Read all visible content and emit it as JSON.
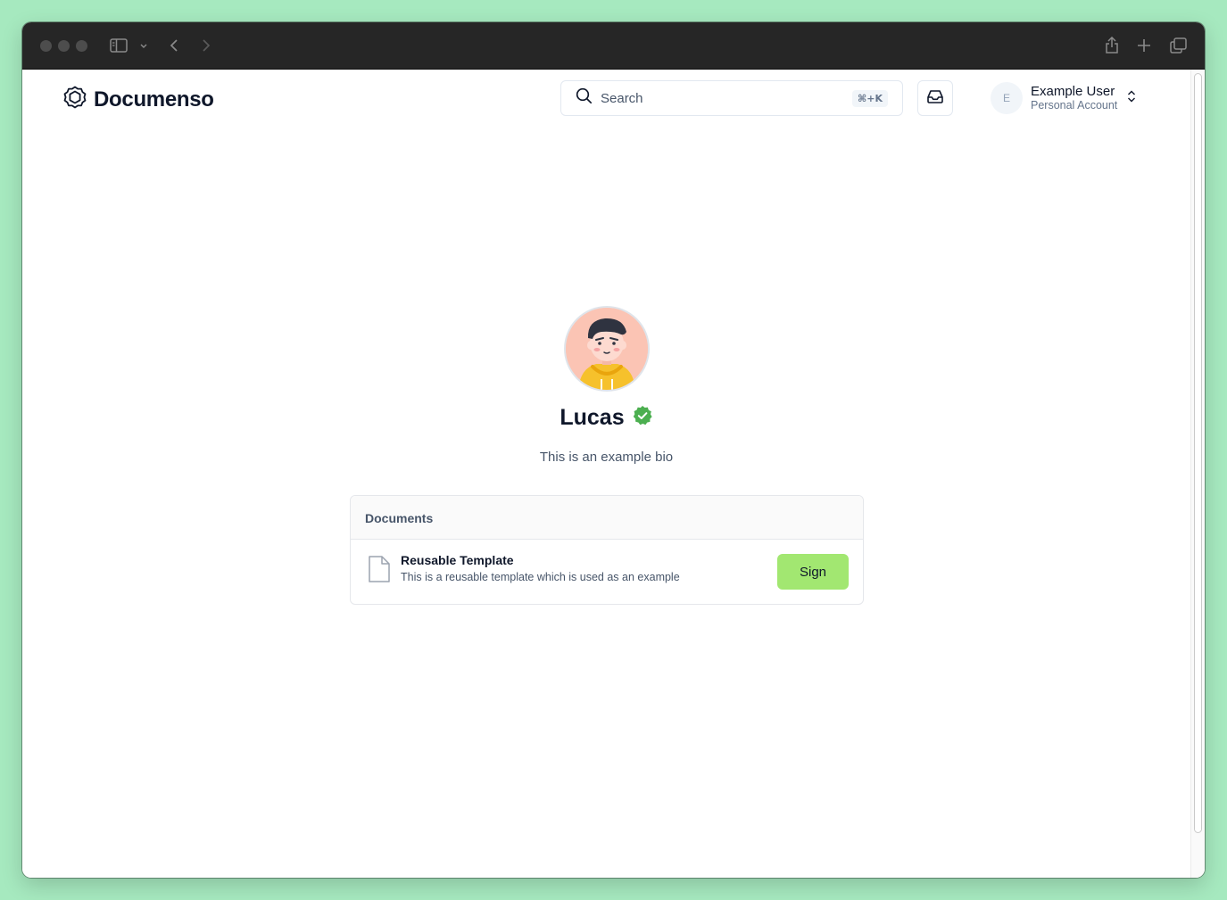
{
  "browser": {
    "buttons": [
      "sidebar-toggle",
      "sidebar-menu",
      "back",
      "forward",
      "share",
      "new-tab",
      "tab-overview"
    ]
  },
  "header": {
    "brand": "Documenso",
    "search": {
      "placeholder": "Search",
      "shortcut": "⌘+K"
    },
    "account": {
      "initial": "E",
      "name": "Example User",
      "type": "Personal Account"
    }
  },
  "profile": {
    "name": "Lucas",
    "verified": true,
    "bio": "This is an example bio"
  },
  "documents": {
    "heading": "Documents",
    "items": [
      {
        "title": "Reusable Template",
        "description": "This is a reusable template which is used as an example",
        "action": "Sign"
      }
    ]
  },
  "colors": {
    "accent": "#a2e771",
    "verified_badge": "#4caf50",
    "page_background": "#a6e9bf",
    "titlebar": "#262626"
  }
}
